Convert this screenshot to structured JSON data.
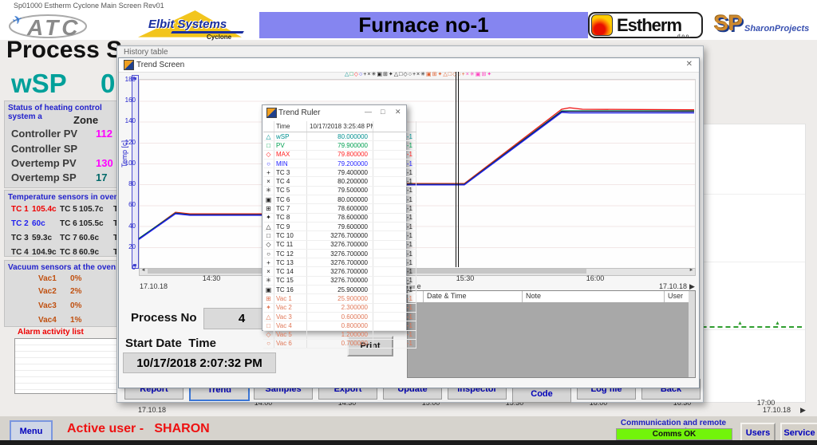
{
  "titlebar": {
    "text": "Sp01000 Estherm Cyclone Main Screen  Rev01"
  },
  "header": {
    "banner": "Furnace no-1",
    "atc_text": "ATC",
    "elbit_name": "Elbit Systems",
    "elbit_sub": "Cyclone",
    "estherm_name": "Estherm",
    "estherm_sub": "d.o.o.",
    "sharon_sp": "SP",
    "sharon_name": "SharonProjects"
  },
  "process": {
    "title": "Process S",
    "wsp_label": "wSP",
    "wsp_value": "0.",
    "status": {
      "header": "Status of heating control system a",
      "zone_label": "Zone",
      "rows": [
        {
          "label": "Controller PV",
          "value": "112",
          "color": "#ff00ff"
        },
        {
          "label": "Controller SP",
          "value": "",
          "color": "#008080"
        },
        {
          "label": "Overtemp PV",
          "value": "130",
          "color": "#ff00ff"
        },
        {
          "label": "Overtemp SP",
          "value": "17",
          "color": "#006868"
        }
      ]
    },
    "temps": {
      "header": "Temperature sensors in oven cavit",
      "rows": [
        {
          "l1": "TC 1",
          "v1": "105.4c",
          "c1": "#ee0000",
          "l2": "TC 5",
          "v2": "105.7c",
          "l3": "TC"
        },
        {
          "l1": "TC 2",
          "v1": "60c",
          "c1": "#2222ee",
          "l2": "TC 6",
          "v2": "105.5c",
          "l3": "TC"
        },
        {
          "l1": "TC 3",
          "v1": "59.3c",
          "c1": "#222222",
          "l2": "TC 7",
          "v2": "60.6c",
          "l3": "TC"
        },
        {
          "l1": "TC 4",
          "v1": "104.9c",
          "c1": "#222222",
          "l2": "TC 8",
          "v2": "60.9c",
          "l3": "TC"
        }
      ]
    },
    "vacuum": {
      "header": "Vacuum sensors at the oven entran",
      "rows": [
        {
          "label": "Vac1",
          "value": "0%"
        },
        {
          "label": "Vac2",
          "value": "2%"
        },
        {
          "label": "Vac3",
          "value": "0%"
        },
        {
          "label": "Vac4",
          "value": "1%"
        }
      ]
    },
    "alarm_header": "Alarm activity list"
  },
  "history": {
    "title": "History table",
    "buttons": [
      {
        "label": "Report"
      },
      {
        "label": "Trend",
        "active": true
      },
      {
        "label": "Samples"
      },
      {
        "label": "Export"
      },
      {
        "label": "Update"
      },
      {
        "label": "Inspector"
      },
      {
        "label": "Code",
        "low": true
      },
      {
        "label": "Log file"
      },
      {
        "label": "Back"
      }
    ]
  },
  "trend": {
    "title": "Trend Screen",
    "close_glyph": "✕",
    "ylabel": "Temp [c]",
    "yticks": [
      180,
      160,
      140,
      120,
      100,
      80,
      60,
      40,
      20,
      0
    ],
    "xticks": [
      {
        "label": "14:30",
        "x": 91
      },
      {
        "label": "15:30",
        "x": 409
      },
      {
        "label": "16:00",
        "x": 572
      }
    ],
    "date_left": "17.10.18",
    "time_label": "Time",
    "date_right": "17.10.18",
    "arrow_right": "▶",
    "legend": [
      {
        "ch": "△",
        "c": "#009090"
      },
      {
        "ch": "□",
        "c": "#00a050"
      },
      {
        "ch": "◇",
        "c": "#ff2222"
      },
      {
        "ch": "○",
        "c": "#2222ff"
      },
      {
        "ch": "+",
        "c": "#222222"
      },
      {
        "ch": "×",
        "c": "#222222"
      },
      {
        "ch": "✳",
        "c": "#222222"
      },
      {
        "ch": "▣",
        "c": "#222222"
      },
      {
        "ch": "⊞",
        "c": "#222222"
      },
      {
        "ch": "✦",
        "c": "#222222"
      },
      {
        "ch": "△",
        "c": "#222222"
      },
      {
        "ch": "□",
        "c": "#222222"
      },
      {
        "ch": "◇",
        "c": "#222222"
      },
      {
        "ch": "○",
        "c": "#222222"
      },
      {
        "ch": "+",
        "c": "#222222"
      },
      {
        "ch": "×",
        "c": "#222222"
      },
      {
        "ch": "✳",
        "c": "#222222"
      },
      {
        "ch": "▣",
        "c": "#e06030"
      },
      {
        "ch": "⊞",
        "c": "#e06030"
      },
      {
        "ch": "✦",
        "c": "#e06030"
      },
      {
        "ch": "△",
        "c": "#e06030"
      },
      {
        "ch": "□",
        "c": "#e06030"
      },
      {
        "ch": "◇",
        "c": "#e06030"
      },
      {
        "ch": "○",
        "c": "#e06030"
      },
      {
        "ch": "+",
        "c": "#e06030"
      },
      {
        "ch": "×",
        "c": "#ff40c0"
      },
      {
        "ch": "✳",
        "c": "#ff40c0"
      },
      {
        "ch": "▣",
        "c": "#ff40c0"
      },
      {
        "ch": "⊞",
        "c": "#ff40c0"
      },
      {
        "ch": "✦",
        "c": "#ff40c0"
      }
    ],
    "series": [
      {
        "name": "MAX",
        "color": "#ee1111",
        "points": [
          [
            0,
            27
          ],
          [
            46,
            52.5
          ],
          [
            64,
            51
          ],
          [
            200,
            51
          ],
          [
            262,
            80
          ],
          [
            408,
            80
          ],
          [
            530,
            151
          ],
          [
            540,
            152.5
          ],
          [
            556,
            151
          ],
          [
            696,
            150.5
          ]
        ]
      },
      {
        "name": "PV",
        "color": "#00a050",
        "points": [
          [
            0,
            27.5
          ],
          [
            46,
            51.8
          ],
          [
            64,
            50.3
          ],
          [
            200,
            50.3
          ],
          [
            262,
            79.3
          ],
          [
            408,
            79.3
          ],
          [
            530,
            149.5
          ],
          [
            696,
            149.5
          ]
        ]
      },
      {
        "name": "wSP",
        "color": "#101060",
        "points": [
          [
            0,
            27
          ],
          [
            46,
            51.4
          ],
          [
            64,
            50
          ],
          [
            200,
            50
          ],
          [
            262,
            79
          ],
          [
            408,
            79
          ],
          [
            530,
            149
          ],
          [
            696,
            148.8
          ]
        ]
      },
      {
        "name": "MIN",
        "color": "#2222ee",
        "points": [
          [
            0,
            26.5
          ],
          [
            46,
            51
          ],
          [
            64,
            49.6
          ],
          [
            200,
            49.6
          ],
          [
            262,
            78.6
          ],
          [
            408,
            78.6
          ],
          [
            530,
            148
          ],
          [
            540,
            147.5
          ],
          [
            696,
            147.5
          ]
        ]
      }
    ],
    "cursor_x": 422,
    "process_no_label": "Process No",
    "process_no_value": "4",
    "start_label": "Start Date  Time",
    "start_value": "10/17/2018 2:07:32 PM",
    "print_label": "Print",
    "notes": {
      "col1": "Date & Time",
      "col2": "Note",
      "col3": "User"
    }
  },
  "ruler": {
    "title": "Trend Ruler",
    "minimize_glyph": "—",
    "maximize_glyph": "□",
    "close_glyph": "✕",
    "time_header": "Time",
    "time_value": "10/17/2018 3:25:48 PM",
    "rows": [
      {
        "sym": "△",
        "name": "wSP",
        "value": "80.000000",
        "extra": "-1",
        "color": "#009090"
      },
      {
        "sym": "□",
        "name": "PV",
        "value": "79.900000",
        "extra": "-1",
        "color": "#00a050"
      },
      {
        "sym": "◇",
        "name": "MAX",
        "value": "79.800000",
        "extra": "-1",
        "color": "#ff2222"
      },
      {
        "sym": "○",
        "name": "MIN",
        "value": "79.200000",
        "extra": "-1",
        "color": "#2222ff"
      },
      {
        "sym": "+",
        "name": "TC 3",
        "value": "79.400000",
        "extra": "-1",
        "color": "#222222"
      },
      {
        "sym": "×",
        "name": "TC 4",
        "value": "80.200000",
        "extra": "-1",
        "color": "#222222"
      },
      {
        "sym": "✳",
        "name": "TC 5",
        "value": "79.500000",
        "extra": "-1",
        "color": "#222222"
      },
      {
        "sym": "▣",
        "name": "TC 6",
        "value": "80.000000",
        "extra": "-1",
        "color": "#222222"
      },
      {
        "sym": "⊞",
        "name": "TC 7",
        "value": "78.600000",
        "extra": "-1",
        "color": "#222222"
      },
      {
        "sym": "✦",
        "name": "TC 8",
        "value": "78.600000",
        "extra": "-1",
        "color": "#222222"
      },
      {
        "sym": "△",
        "name": "TC 9",
        "value": "79.600000",
        "extra": "-1",
        "color": "#222222"
      },
      {
        "sym": "□",
        "name": "TC 10",
        "value": "3276.700000",
        "extra": "-1",
        "color": "#222222"
      },
      {
        "sym": "◇",
        "name": "TC 11",
        "value": "3276.700000",
        "extra": "-1",
        "color": "#222222"
      },
      {
        "sym": "○",
        "name": "TC 12",
        "value": "3276.700000",
        "extra": "-1",
        "color": "#222222"
      },
      {
        "sym": "+",
        "name": "TC 13",
        "value": "3276.700000",
        "extra": "-1",
        "color": "#222222"
      },
      {
        "sym": "×",
        "name": "TC 14",
        "value": "3276.700000",
        "extra": "-1",
        "color": "#222222"
      },
      {
        "sym": "✳",
        "name": "TC 15",
        "value": "3276.700000",
        "extra": "-1",
        "color": "#222222"
      },
      {
        "sym": "▣",
        "name": "TC 16",
        "value": "25.900000",
        "extra": "-1",
        "color": "#222222"
      },
      {
        "sym": "⊞",
        "name": "Vac 1",
        "value": "25.900000",
        "extra": "-1",
        "color": "#e07858"
      },
      {
        "sym": "✦",
        "name": "Vac 2",
        "value": "2.300000",
        "extra": "-1",
        "color": "#e07858"
      },
      {
        "sym": "△",
        "name": "Vac 3",
        "value": "0.600000",
        "extra": "-1",
        "color": "#e07858"
      },
      {
        "sym": "□",
        "name": "Vac 4",
        "value": "0.800000",
        "extra": "-1",
        "color": "#e07858"
      },
      {
        "sym": "◇",
        "name": "Vac 5",
        "value": "1.200000",
        "extra": "-1",
        "color": "#e07858"
      },
      {
        "sym": "○",
        "name": "Vac 6",
        "value": "0.700000",
        "extra": "-1",
        "color": "#e07858"
      }
    ]
  },
  "background_chart": {
    "xticks": [
      "14:00",
      "14:30",
      "15:00",
      "15:30",
      "16:00",
      "16:30",
      "17:00"
    ],
    "date_left": "17.10.18",
    "date_right": "17.10.18"
  },
  "statusbar": {
    "menu": "Menu",
    "active_user": "Active user -   SHARON",
    "comm_label": "Communication and remote control",
    "comm_status": "Comms OK",
    "users": "Users",
    "service": "Service"
  }
}
